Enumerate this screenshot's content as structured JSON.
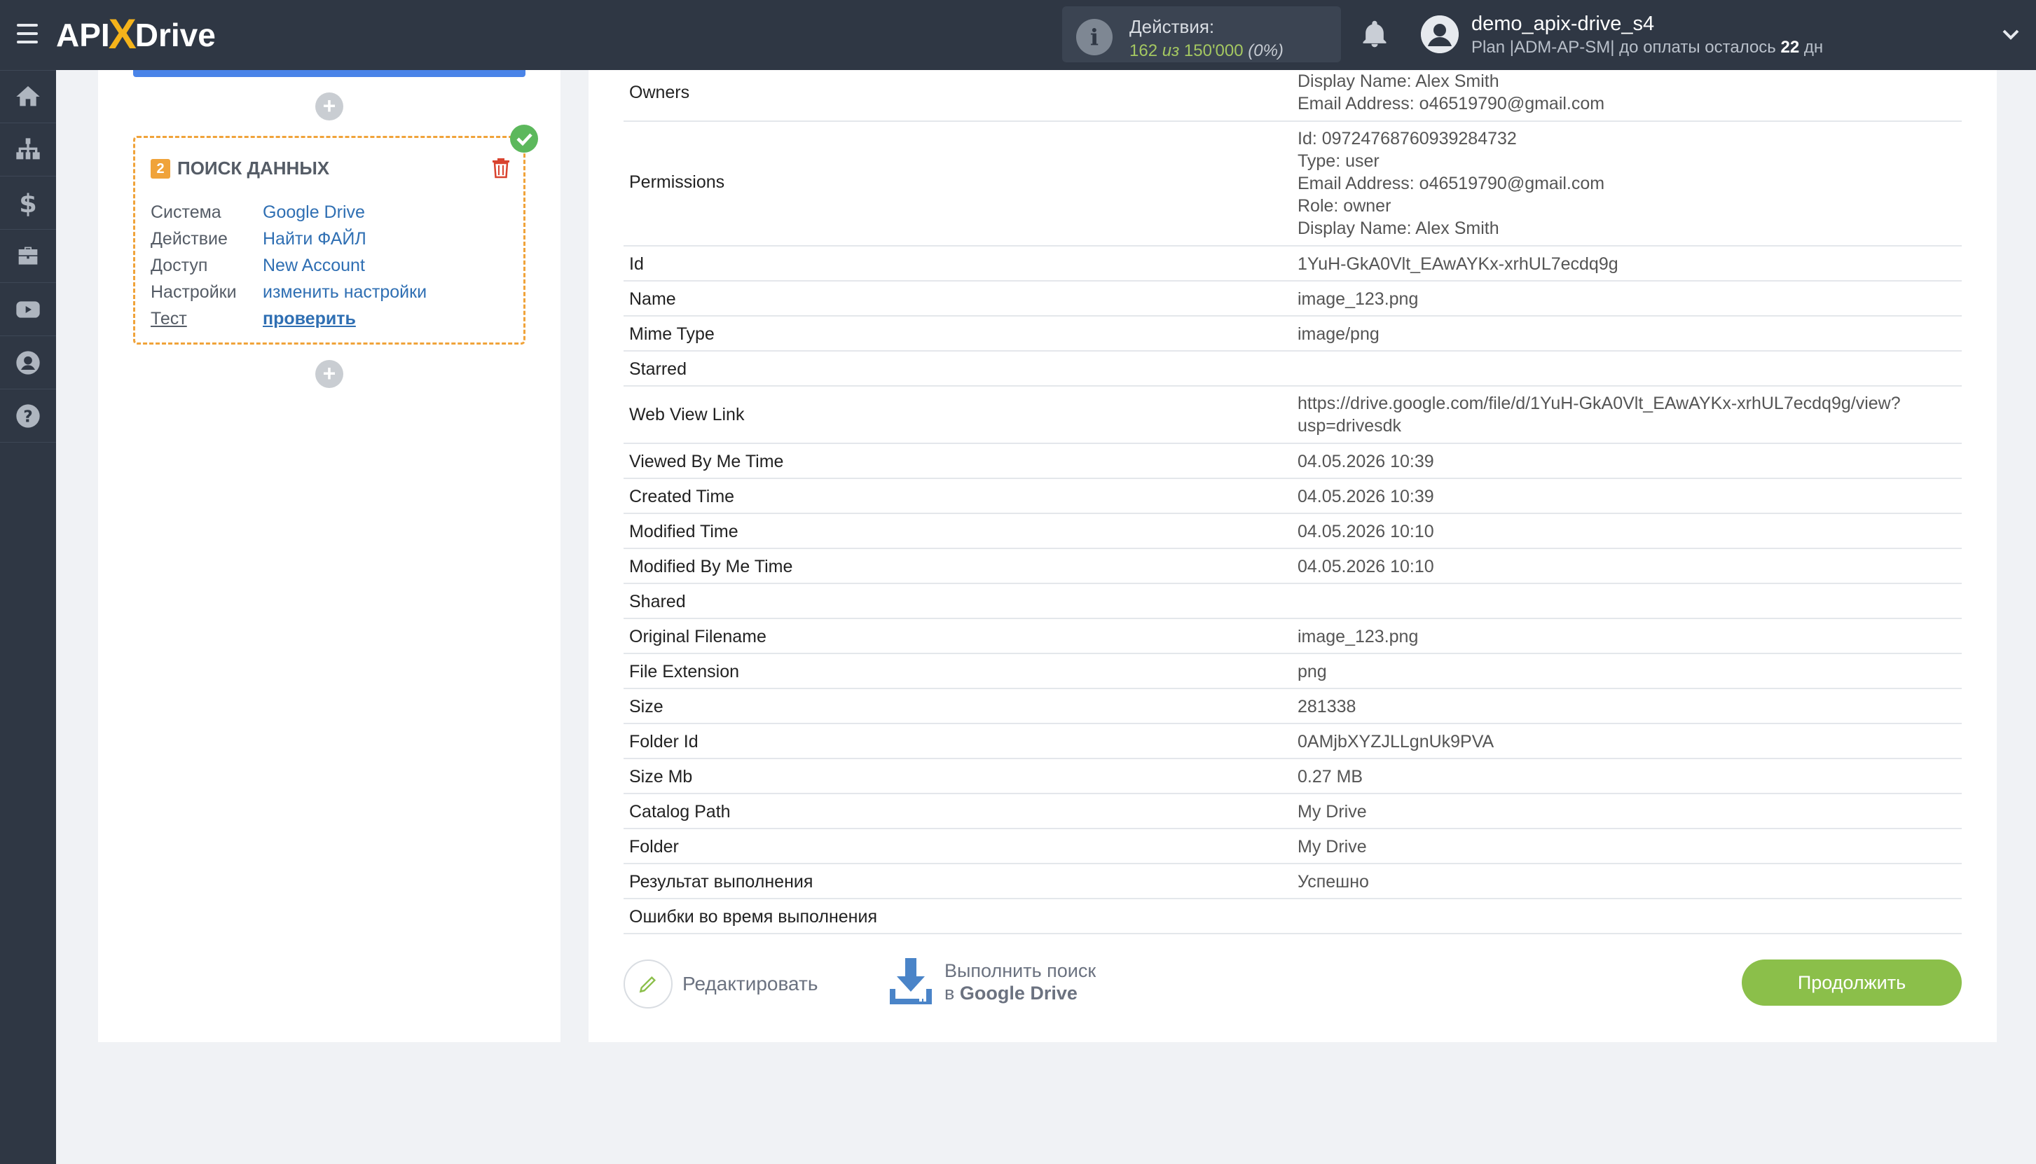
{
  "header": {
    "logo_left": "API",
    "logo_x": "X",
    "logo_right": "Drive",
    "actions_label": "Действия:",
    "actions_used": "162",
    "actions_of": "из",
    "actions_total": "150'000",
    "actions_pct": "(0%)",
    "user_name": "demo_apix-drive_s4",
    "plan_prefix": "Plan |ADM-AP-SM| до оплаты осталось ",
    "plan_days": "22",
    "plan_suffix": " дн"
  },
  "sidenav": {
    "items": [
      "home-icon",
      "sitemap-icon",
      "dollar-icon",
      "briefcase-icon",
      "youtube-icon",
      "user-icon",
      "help-icon"
    ]
  },
  "step": {
    "number": "2",
    "title": "ПОИСК ДАННЫХ",
    "rows": [
      {
        "k": "Система",
        "v": "Google Drive"
      },
      {
        "k": "Действие",
        "v": "Найти ФАЙЛ"
      },
      {
        "k": "Доступ",
        "v": "New Account"
      },
      {
        "k": "Настройки",
        "v": "изменить настройки"
      },
      {
        "k": "Тест",
        "v": "проверить"
      }
    ],
    "plus": "+"
  },
  "result": {
    "rows": [
      {
        "k": "Owners",
        "v": [
          "Display Name: Alex Smith",
          "Email Address: o46519790@gmail.com"
        ]
      },
      {
        "k": "Permissions",
        "v": [
          "Id: 09724768760939284732",
          "Type: user",
          "Email Address: o46519790@gmail.com",
          "Role: owner",
          "Display Name: Alex Smith"
        ]
      },
      {
        "k": "Id",
        "v": [
          "1YuH-GkA0Vlt_EAwAYKx-xrhUL7ecdq9g"
        ]
      },
      {
        "k": "Name",
        "v": [
          "image_123.png"
        ]
      },
      {
        "k": "Mime Type",
        "v": [
          "image/png"
        ]
      },
      {
        "k": "Starred",
        "v": [
          ""
        ]
      },
      {
        "k": "Web View Link",
        "v": [
          "https://drive.google.com/file/d/1YuH-GkA0Vlt_EAwAYKx-xrhUL7ecdq9g/view?",
          "usp=drivesdk"
        ]
      },
      {
        "k": "Viewed By Me Time",
        "v": [
          "04.05.2026 10:39"
        ]
      },
      {
        "k": "Created Time",
        "v": [
          "04.05.2026 10:39"
        ]
      },
      {
        "k": "Modified Time",
        "v": [
          "04.05.2026 10:10"
        ]
      },
      {
        "k": "Modified By Me Time",
        "v": [
          "04.05.2026 10:10"
        ]
      },
      {
        "k": "Shared",
        "v": [
          ""
        ]
      },
      {
        "k": "Original Filename",
        "v": [
          "image_123.png"
        ]
      },
      {
        "k": "File Extension",
        "v": [
          "png"
        ]
      },
      {
        "k": "Size",
        "v": [
          "281338"
        ]
      },
      {
        "k": "Folder Id",
        "v": [
          "0AMjbXYZJLLgnUk9PVA"
        ]
      },
      {
        "k": "Size Mb",
        "v": [
          "0.27 MB"
        ]
      },
      {
        "k": "Catalog Path",
        "v": [
          "My Drive"
        ]
      },
      {
        "k": "Folder",
        "v": [
          "My Drive"
        ]
      },
      {
        "k": "Результат выполнения",
        "v": [
          "Успешно"
        ]
      },
      {
        "k": "Ошибки во время выполнения",
        "v": [
          ""
        ]
      }
    ]
  },
  "buttons": {
    "edit": "Редактировать",
    "run_line1": "Выполнить поиск",
    "run_line2_prefix": "в ",
    "run_line2_bold": "Google Drive",
    "continue": "Продолжить"
  },
  "colors": {
    "topbar": "#2f3744",
    "accent_green": "#8bbf4a",
    "link_blue": "#2f6fb3",
    "step_orange": "#f0a33a"
  }
}
